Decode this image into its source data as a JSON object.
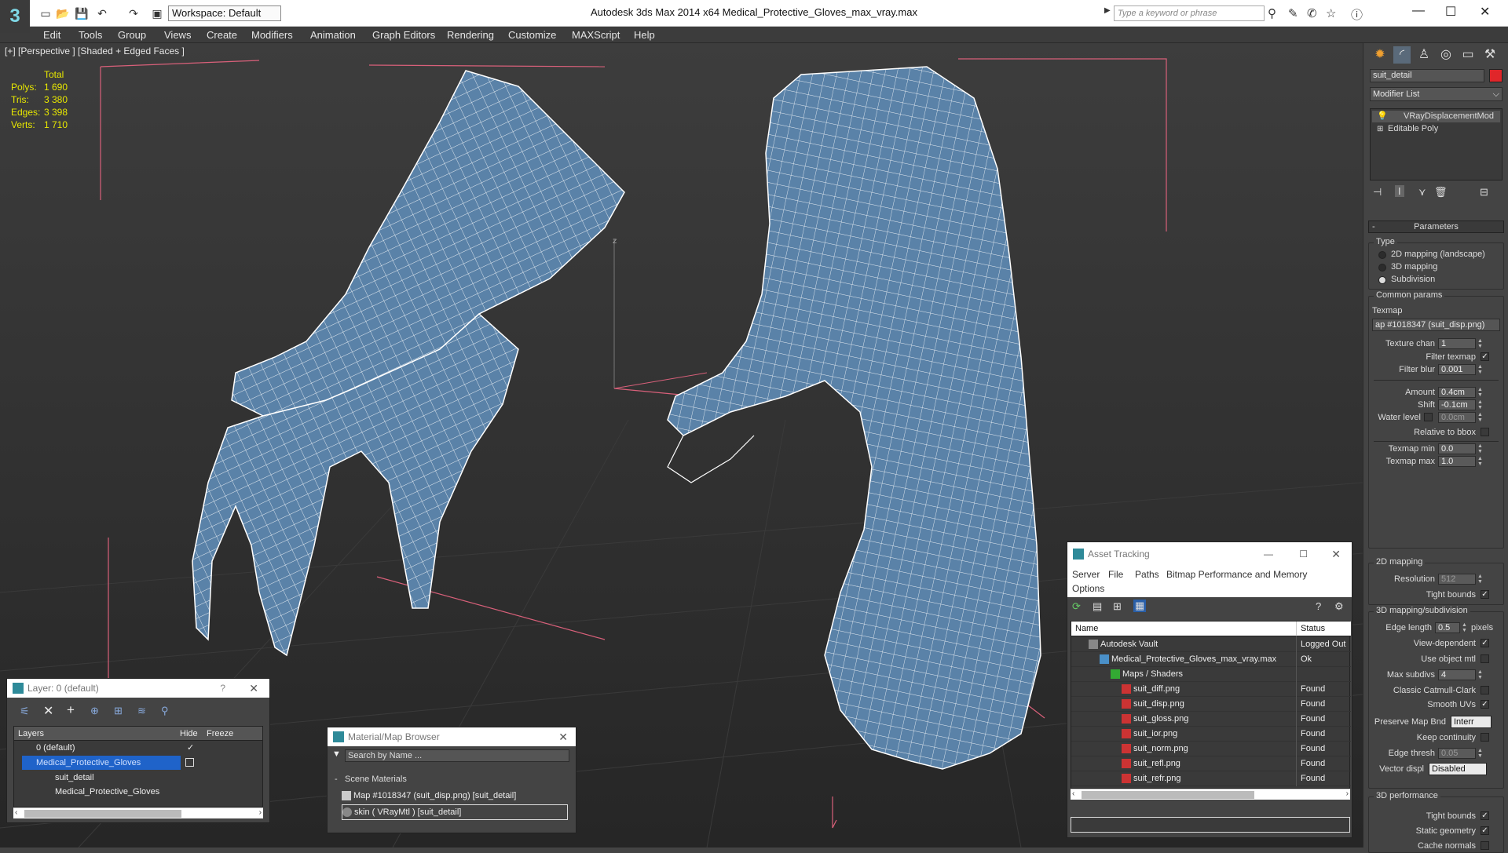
{
  "app": {
    "title": "Autodesk 3ds Max  2014 x64      Medical_Protective_Gloves_max_vray.max",
    "workspace": "Workspace: Default",
    "search_placeholder": "Type a keyword or phrase",
    "logo": "3"
  },
  "menu": [
    "Edit",
    "Tools",
    "Group",
    "Views",
    "Create",
    "Modifiers",
    "Animation",
    "Graph Editors",
    "Rendering",
    "Customize",
    "MAXScript",
    "Help"
  ],
  "viewport": {
    "label": "[+] [Perspective ] [Shaded + Edged Faces ]",
    "stats": {
      "header": "Total",
      "rows": [
        {
          "k": "Polys:",
          "v": "1 690"
        },
        {
          "k": "Tris:",
          "v": "3 380"
        },
        {
          "k": "Edges:",
          "v": "3 398"
        },
        {
          "k": "Verts:",
          "v": "1 710"
        }
      ]
    },
    "axis_label": "z"
  },
  "command_panel": {
    "object_name": "suit_detail",
    "object_color": "#e0262a",
    "modifier_list": "Modifier List",
    "stack": [
      "VRayDisplacementMod",
      "Editable Poly"
    ],
    "parameters_title": "Parameters",
    "type_title": "Type",
    "type_options": [
      "2D mapping (landscape)",
      "3D mapping",
      "Subdivision"
    ],
    "type_selected": 2,
    "common_params": "Common params",
    "texmap_label": "Texmap",
    "texmap_value": "ap #1018347 (suit_disp.png)",
    "texture_chan_label": "Texture chan",
    "texture_chan": "1",
    "filter_texmap": "Filter texmap",
    "filter_blur_label": "Filter blur",
    "filter_blur": "0.001",
    "amount_label": "Amount",
    "amount": "0.4cm",
    "shift_label": "Shift",
    "shift": "-0.1cm",
    "water_level_label": "Water level",
    "water_level": "0.0cm",
    "relative_bbox": "Relative to bbox",
    "texmap_min_label": "Texmap min",
    "texmap_min": "0.0",
    "texmap_max_label": "Texmap max",
    "texmap_max": "1.0",
    "mapping2d_title": "2D mapping",
    "resolution_label": "Resolution",
    "resolution": "512",
    "tight_bounds": "Tight bounds",
    "mapping3d_title": "3D mapping/subdivision",
    "edge_length_label": "Edge length",
    "edge_length": "0.5",
    "pixels": "pixels",
    "view_dependent": "View-dependent",
    "use_object_mtl": "Use object mtl",
    "max_subdivs_label": "Max subdivs",
    "max_subdivs": "4",
    "classic_catmull": "Classic Catmull-Clark",
    "smooth_uvs": "Smooth UVs",
    "preserve_map_label": "Preserve Map Bnd",
    "preserve_map": "Interr",
    "keep_continuity": "Keep continuity",
    "edge_thresh_label": "Edge thresh",
    "edge_thresh": "0.05",
    "vector_displ_label": "Vector displ",
    "vector_displ": "Disabled",
    "perf_title": "3D performance",
    "perf_tight_bounds": "Tight bounds",
    "static_geometry": "Static geometry",
    "cache_normals": "Cache normals"
  },
  "layer_panel": {
    "title": "Layer: 0 (default)",
    "help": "?",
    "col_layers": "Layers",
    "col_hide": "Hide",
    "col_freeze": "Freeze",
    "rows": [
      "0 (default)",
      "Medical_Protective_Gloves",
      "suit_detail",
      "Medical_Protective_Gloves"
    ]
  },
  "material_browser": {
    "title": "Material/Map Browser",
    "search_placeholder": "Search by Name ...",
    "section": "Scene Materials",
    "items": [
      "Map #1018347 (suit_disp.png) [suit_detail]",
      "skin  ( VRayMtl ) [suit_detail]"
    ]
  },
  "asset_tracking": {
    "title": "Asset Tracking",
    "menu": [
      "Server",
      "File",
      "Paths",
      "Bitmap Performance and Memory",
      "Options"
    ],
    "col_name": "Name",
    "col_status": "Status",
    "rows": [
      {
        "name": "Autodesk Vault",
        "status": "Logged Out",
        "indent": 1
      },
      {
        "name": "Medical_Protective_Gloves_max_vray.max",
        "status": "Ok",
        "indent": 2
      },
      {
        "name": "Maps / Shaders",
        "status": "",
        "indent": 3
      },
      {
        "name": "suit_diff.png",
        "status": "Found",
        "indent": 4
      },
      {
        "name": "suit_disp.png",
        "status": "Found",
        "indent": 4
      },
      {
        "name": "suit_gloss.png",
        "status": "Found",
        "indent": 4
      },
      {
        "name": "suit_ior.png",
        "status": "Found",
        "indent": 4
      },
      {
        "name": "suit_norm.png",
        "status": "Found",
        "indent": 4
      },
      {
        "name": "suit_refl.png",
        "status": "Found",
        "indent": 4
      },
      {
        "name": "suit_refr.png",
        "status": "Found",
        "indent": 4
      }
    ]
  },
  "colors": {
    "glove": "#5a82a8",
    "selection": "#1f63c9",
    "gizmo": "#d9607a"
  }
}
